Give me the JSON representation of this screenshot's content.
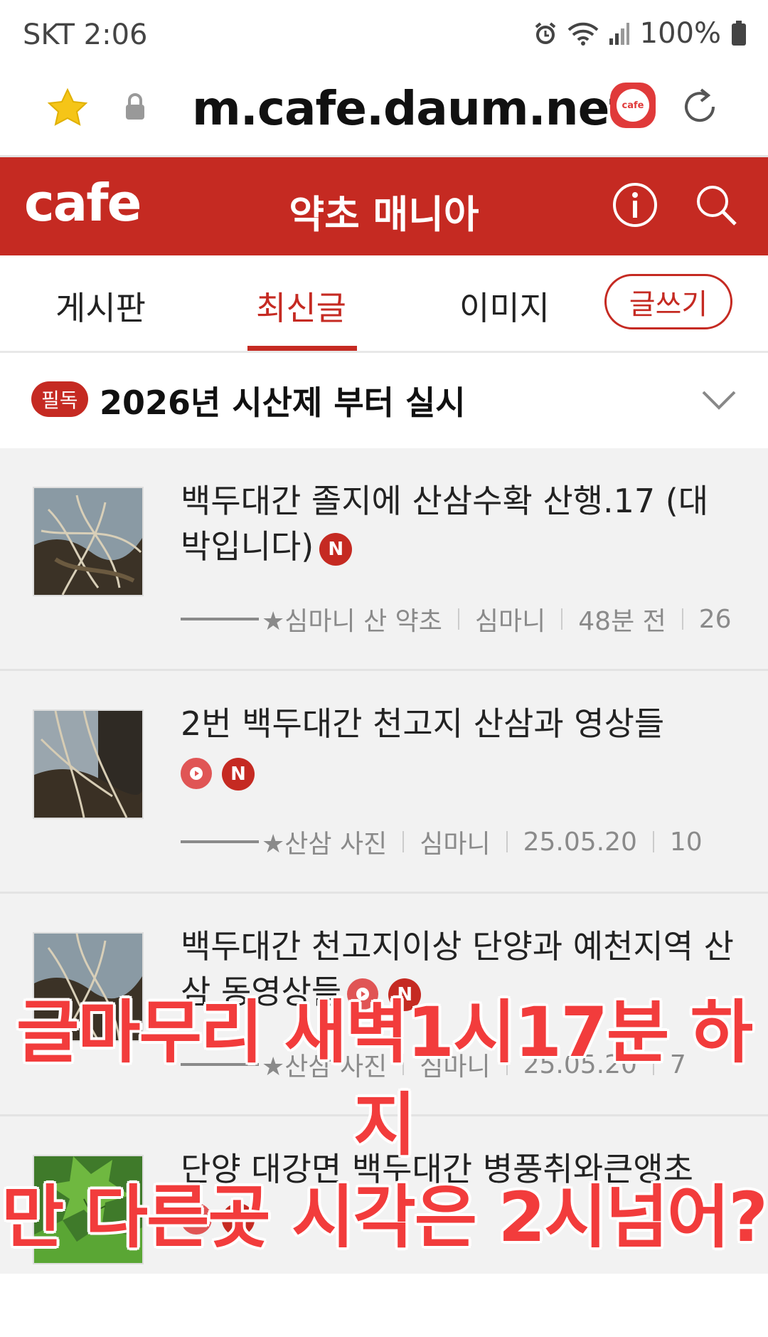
{
  "status": {
    "carrier_time": "SKT 2:06",
    "battery": "100%"
  },
  "browser": {
    "url": "m.cafe.daum.net",
    "cafe_badge": "cafe"
  },
  "header": {
    "logo": "cafe",
    "title": "약초 매니아"
  },
  "tabs": {
    "board": "게시판",
    "latest": "최신글",
    "image": "이미지",
    "write": "글쓰기"
  },
  "notice": {
    "badge": "필독",
    "text": "2026년 시산제 부터 실시"
  },
  "posts": [
    {
      "title": "백두대간 졸지에 산삼수확 산행.17 (대박입니다)",
      "category": "★심마니 산 약초",
      "author": "심마니",
      "time": "48분 전",
      "count": "26"
    },
    {
      "title": "2번 백두대간 천고지 산삼과 영상들",
      "category": "★산삼 사진",
      "author": "심마니",
      "time": "25.05.20",
      "count": "10"
    },
    {
      "title": "백두대간 천고지이상 단양과 예천지역 산삼 동영상들",
      "category": "★산삼 사진",
      "author": "심마니",
      "time": "25.05.20",
      "count": "7"
    },
    {
      "title": "단양 대강면 백두대간 병풍취와큰앵초"
    }
  ],
  "badges": {
    "new": "N"
  },
  "overlay": {
    "line1": "글마무리 새벽1시17분 하지",
    "line2": "만 다른곳 시각은 2시넘어?"
  },
  "colors": {
    "brand_red": "#c52a22",
    "overlay_red": "#f23c3c"
  }
}
